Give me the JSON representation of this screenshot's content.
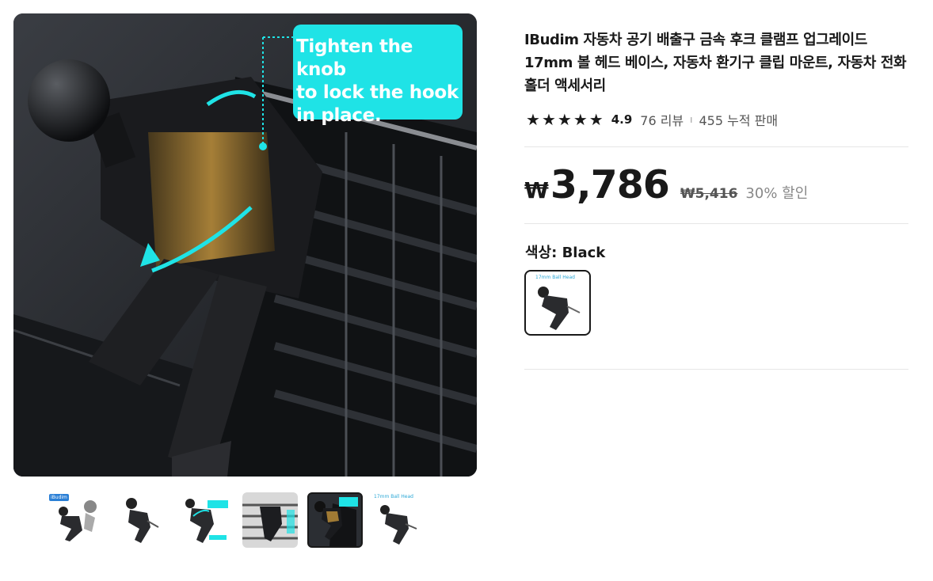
{
  "gallery": {
    "main_image_callout": "Tighten the knob\nto lock the hook\nin place.",
    "thumbnails": [
      {
        "tag": "iBudim",
        "selected": false
      },
      {
        "tag": "",
        "selected": false
      },
      {
        "tag": "",
        "selected": false
      },
      {
        "tag": "",
        "selected": false
      },
      {
        "tag": "",
        "selected": true
      },
      {
        "tag": "17mm Ball Head",
        "selected": false
      }
    ]
  },
  "product": {
    "title": "IBudim 자동차 공기 배출구 금속 후크 클램프 업그레이드 17mm 볼 헤드 베이스, 자동차 환기구 클립 마운트, 자동차 전화 홀더 액세서리",
    "rating": "4.9",
    "reviews": "76 리뷰",
    "separator": "ı",
    "sold": "455 누적 판매",
    "star_count": 5,
    "price_symbol": "₩",
    "price": "3,786",
    "original_price": "₩5,416",
    "discount": "30% 할인",
    "color_label": "색상: Black",
    "color_option_tag": "17mm Ball Head"
  }
}
